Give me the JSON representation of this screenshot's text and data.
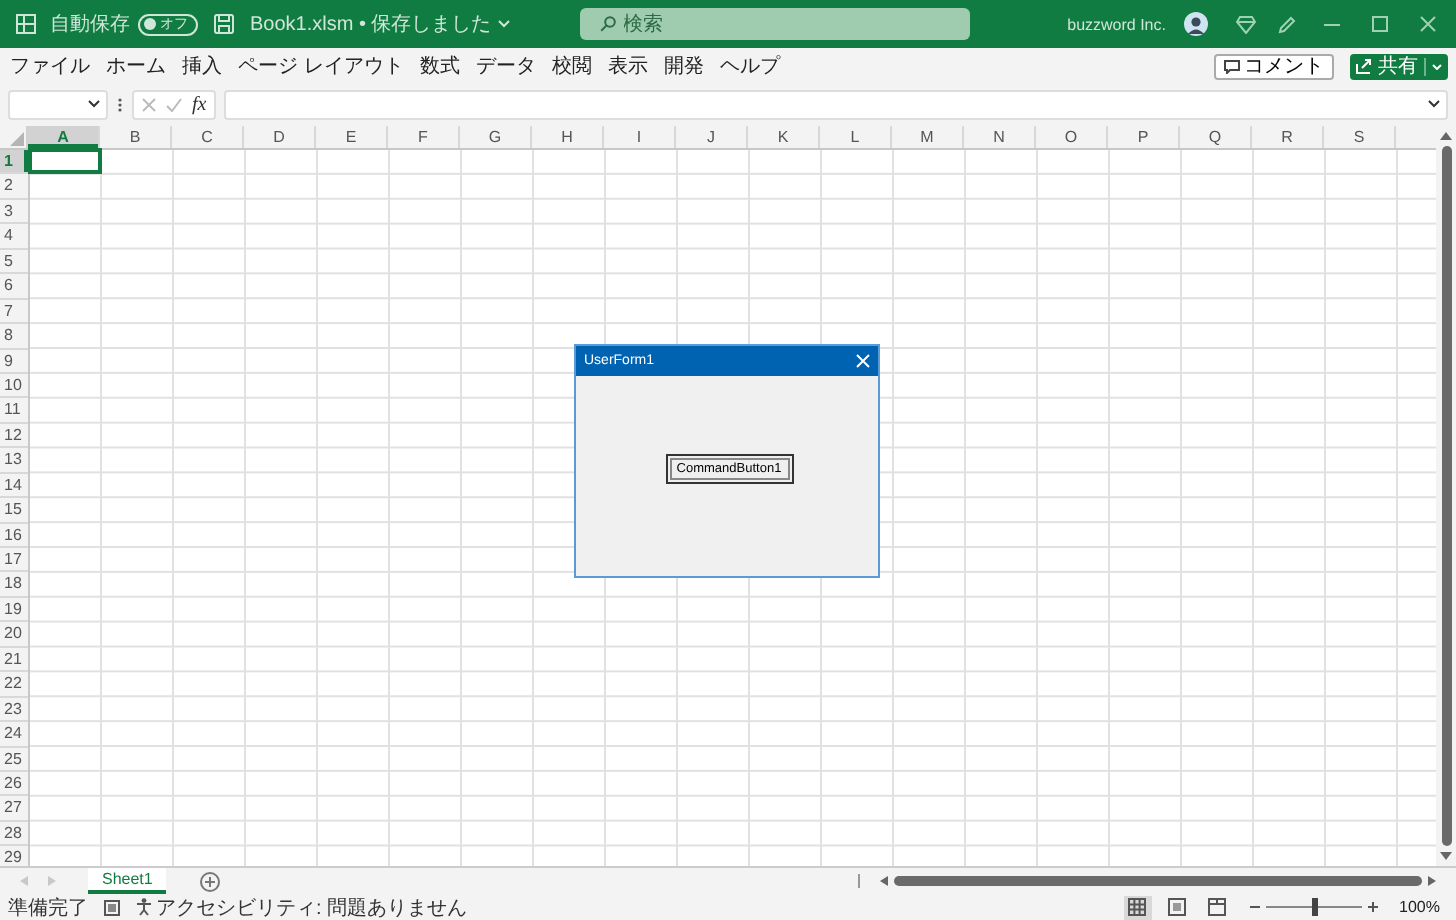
{
  "title_bar": {
    "autosave": {
      "label": "自動保存",
      "state_label": "オフ",
      "on": false
    },
    "file_title": "Book1.xlsm • 保存しました",
    "search": {
      "placeholder": "検索"
    },
    "user": "buzzword Inc."
  },
  "menu": [
    {
      "label": "ファイル"
    },
    {
      "label": "ホーム"
    },
    {
      "label": "挿入"
    },
    {
      "label": "ページ レイアウト"
    },
    {
      "label": "数式"
    },
    {
      "label": "データ"
    },
    {
      "label": "校閲"
    },
    {
      "label": "表示"
    },
    {
      "label": "開発"
    },
    {
      "label": "ヘルプ"
    }
  ],
  "ribbon_buttons": {
    "comment": "コメント",
    "share": "共有"
  },
  "formula_bar": {
    "function_symbol": "fx"
  },
  "columns": [
    {
      "label": "A",
      "selected": true
    },
    {
      "label": "B",
      "selected": false
    },
    {
      "label": "C",
      "selected": false
    },
    {
      "label": "D",
      "selected": false
    },
    {
      "label": "E",
      "selected": false
    },
    {
      "label": "F",
      "selected": false
    },
    {
      "label": "G",
      "selected": false
    },
    {
      "label": "H",
      "selected": false
    },
    {
      "label": "I",
      "selected": false
    },
    {
      "label": "J",
      "selected": false
    },
    {
      "label": "K",
      "selected": false
    },
    {
      "label": "L",
      "selected": false
    },
    {
      "label": "M",
      "selected": false
    },
    {
      "label": "N",
      "selected": false
    },
    {
      "label": "O",
      "selected": false
    },
    {
      "label": "P",
      "selected": false
    },
    {
      "label": "Q",
      "selected": false
    },
    {
      "label": "R",
      "selected": false
    },
    {
      "label": "S",
      "selected": false
    }
  ],
  "rows": [
    {
      "label": "1",
      "selected": true
    },
    {
      "label": "2",
      "selected": false
    },
    {
      "label": "3",
      "selected": false
    },
    {
      "label": "4",
      "selected": false
    },
    {
      "label": "5",
      "selected": false
    },
    {
      "label": "6",
      "selected": false
    },
    {
      "label": "7",
      "selected": false
    },
    {
      "label": "8",
      "selected": false
    },
    {
      "label": "9",
      "selected": false
    },
    {
      "label": "10",
      "selected": false
    },
    {
      "label": "11",
      "selected": false
    },
    {
      "label": "12",
      "selected": false
    },
    {
      "label": "13",
      "selected": false
    },
    {
      "label": "14",
      "selected": false
    },
    {
      "label": "15",
      "selected": false
    },
    {
      "label": "16",
      "selected": false
    },
    {
      "label": "17",
      "selected": false
    },
    {
      "label": "18",
      "selected": false
    },
    {
      "label": "19",
      "selected": false
    },
    {
      "label": "20",
      "selected": false
    },
    {
      "label": "21",
      "selected": false
    },
    {
      "label": "22",
      "selected": false
    },
    {
      "label": "23",
      "selected": false
    },
    {
      "label": "24",
      "selected": false
    },
    {
      "label": "25",
      "selected": false
    },
    {
      "label": "26",
      "selected": false
    },
    {
      "label": "27",
      "selected": false
    },
    {
      "label": "28",
      "selected": false
    },
    {
      "label": "29",
      "selected": false
    }
  ],
  "dialog": {
    "title": "UserForm1",
    "button": "CommandButton1"
  },
  "sheet_tabs": [
    {
      "label": "Sheet1",
      "selected": true
    }
  ],
  "status_bar": {
    "ready": "準備完了",
    "accessibility": "アクセシビリティ: 問題ありません",
    "views": [
      {
        "kind": "normal",
        "selected": true
      },
      {
        "kind": "page_layout",
        "selected": false
      },
      {
        "kind": "page_break",
        "selected": false
      }
    ],
    "zoom": {
      "level": 0.5,
      "reading": "100%"
    }
  }
}
